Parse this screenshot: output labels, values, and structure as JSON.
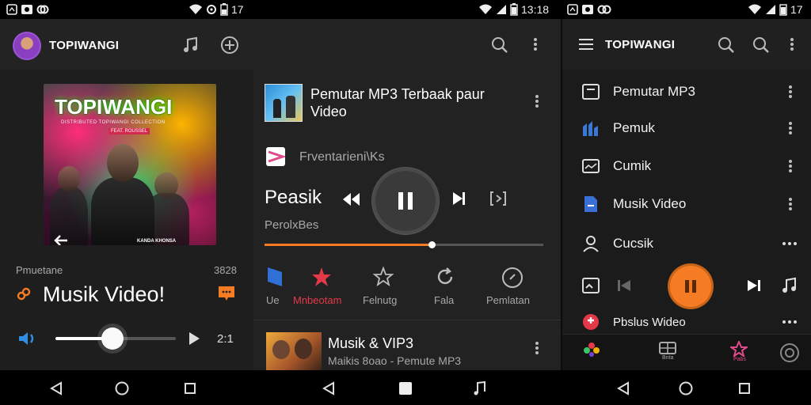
{
  "status_bar": {
    "time_left": "17",
    "time_middle": "13:18",
    "time_right": "17"
  },
  "left_panel": {
    "app_title": "TOPIWANGI",
    "album_art_title": "TOPIWANGI",
    "album_art_subtitle": "DISTRIBUTED TOPIWANGI COLLECTION",
    "album_art_badge": "FEAT. ROUSSEL",
    "album_art_bottom": "KANDA KHONSA",
    "artist_label": "Pmuetane",
    "count_label": "3828",
    "song_title": "Musik Video!",
    "track_time": "2:1"
  },
  "middle_panel": {
    "item1_title": "Pemutar MP3 Terbaak paur Video",
    "source_label": "Frventarieni\\Ks",
    "now_title": "Peasik",
    "now_subtitle": "PerolxBes",
    "progress": 0.6,
    "tabs": [
      {
        "label": "Ue",
        "active": false
      },
      {
        "label": "Mnbeotam",
        "active": true
      },
      {
        "label": "Felnutg",
        "active": false
      },
      {
        "label": "Fala",
        "active": false
      },
      {
        "label": "Pemlatan",
        "active": false
      }
    ],
    "item2_title": "Musik & VIP3",
    "item2_subtitle": "Maikis 8oao - Pemute MP3"
  },
  "right_panel": {
    "app_title": "TOPIWANGI",
    "menu": [
      {
        "label": "Pemutar MP3"
      },
      {
        "label": "Pemuk"
      },
      {
        "label": "Cumik"
      },
      {
        "label": "Musik Video"
      },
      {
        "label": "Cucsik"
      }
    ],
    "partial_item": "Pbslus Wideo",
    "bottom_nav_labels": [
      "",
      "Bnta",
      "Pabs"
    ]
  },
  "colors": {
    "accent_orange": "#f57c22",
    "accent_red": "#e5394a",
    "accent_blue": "#2f8fe6",
    "accent_pink": "#e04a8a"
  }
}
